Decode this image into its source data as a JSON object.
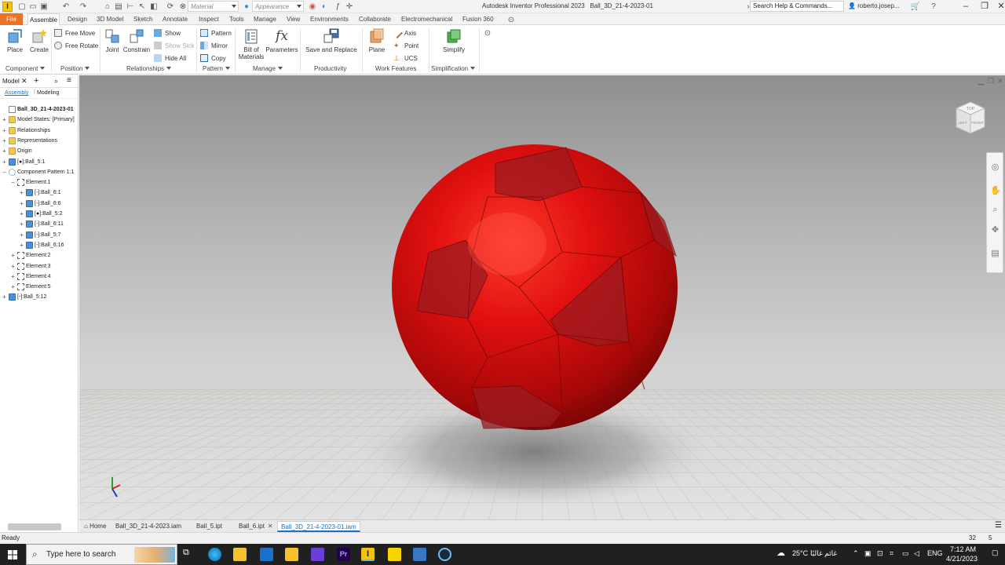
{
  "titlebar": {
    "material_placeholder": "Material",
    "appearance_placeholder": "Appearance",
    "app_title": "Autodesk Inventor Professional 2023",
    "doc_title": "Ball_3D_21-4-2023-01",
    "search_placeholder": "Search Help & Commands...",
    "user": "roberto.josep..."
  },
  "tabs": [
    "File",
    "Assemble",
    "Design",
    "3D Model",
    "Sketch",
    "Annotate",
    "Inspect",
    "Tools",
    "Manage",
    "View",
    "Environments",
    "Collaborate",
    "Electromechanical",
    "Fusion 360"
  ],
  "active_tab": "Assemble",
  "ribbon": {
    "component": {
      "place": "Place",
      "create": "Create",
      "label": "Component"
    },
    "position": {
      "free_move": "Free Move",
      "free_rotate": "Free Rotate",
      "label": "Position"
    },
    "relationships": {
      "joint": "Joint",
      "constrain": "Constrain",
      "show": "Show",
      "show_sick": "Show Sick",
      "hide_all": "Hide All",
      "label": "Relationships"
    },
    "pattern": {
      "pattern": "Pattern",
      "mirror": "Mirror",
      "copy": "Copy",
      "label": "Pattern"
    },
    "manage": {
      "bom_line1": "Bill of",
      "bom_line2": "Materials",
      "parameters": "Parameters",
      "label": "Manage"
    },
    "productivity": {
      "save_replace": "Save and Replace",
      "label": "Productivity"
    },
    "work_features": {
      "plane": "Plane",
      "axis": "Axis",
      "point": "Point",
      "ucs": "UCS",
      "label": "Work Features"
    },
    "simplification": {
      "simplify": "Simplify",
      "label": "Simplification"
    }
  },
  "browser": {
    "title": "Model",
    "subtab_assembly": "Assembly",
    "subtab_modeling": "Modeling",
    "tree": [
      {
        "label": "Ball_3D_21-4-2023-01",
        "indent": 0,
        "expander": "",
        "icon": "doc",
        "bold": true
      },
      {
        "label": "Model States: [Primary]",
        "indent": 0,
        "expander": "+",
        "icon": "folder"
      },
      {
        "label": "Relationships",
        "indent": 0,
        "expander": "+",
        "icon": "folder"
      },
      {
        "label": "Representations",
        "indent": 0,
        "expander": "+",
        "icon": "folder"
      },
      {
        "label": "Origin",
        "indent": 0,
        "expander": "+",
        "icon": "folder"
      },
      {
        "label": "[●]:Ball_5:1",
        "indent": 0,
        "expander": "+",
        "icon": "part"
      },
      {
        "label": "Component Pattern 1:1",
        "indent": 0,
        "expander": "−",
        "icon": "pattern"
      },
      {
        "label": "Element:1",
        "indent": 1,
        "expander": "−",
        "icon": "elem"
      },
      {
        "label": "[-]:Ball_6:1",
        "indent": 2,
        "expander": "+",
        "icon": "part"
      },
      {
        "label": "[-]:Ball_6:6",
        "indent": 2,
        "expander": "+",
        "icon": "part"
      },
      {
        "label": "[●]:Ball_5:2",
        "indent": 2,
        "expander": "+",
        "icon": "part"
      },
      {
        "label": "[-]:Ball_6:11",
        "indent": 2,
        "expander": "+",
        "icon": "part"
      },
      {
        "label": "[-]:Ball_5:7",
        "indent": 2,
        "expander": "+",
        "icon": "part"
      },
      {
        "label": "[-]:Ball_6:16",
        "indent": 2,
        "expander": "+",
        "icon": "part"
      },
      {
        "label": "Element:2",
        "indent": 1,
        "expander": "+",
        "icon": "elem"
      },
      {
        "label": "Element:3",
        "indent": 1,
        "expander": "+",
        "icon": "elem"
      },
      {
        "label": "Element:4",
        "indent": 1,
        "expander": "+",
        "icon": "elem"
      },
      {
        "label": "Element:5",
        "indent": 1,
        "expander": "+",
        "icon": "elem"
      },
      {
        "label": "[-]:Ball_5:12",
        "indent": 0,
        "expander": "+",
        "icon": "part"
      }
    ]
  },
  "viewcube": {
    "top": "TOP",
    "left": "LEFT",
    "front": "FRONT"
  },
  "doc_tabs": {
    "home": "Home",
    "items": [
      "Ball_3D_21-4-2023.iam",
      "Ball_5.ipt",
      "Ball_6.ipt",
      "Ball_3D_21-4-2023-01.iam"
    ],
    "active_index": 3
  },
  "status": {
    "text": "Ready",
    "count1": "32",
    "count2": "5"
  },
  "taskbar": {
    "search_placeholder": "Type here to search",
    "temperature": "25°C",
    "weather_text": "غائم غالبًا",
    "language": "ENG",
    "time": "7:12 AM",
    "date": "4/21/2023"
  },
  "colors": {
    "accent": "#1a73c9",
    "file_tab": "#e8742a",
    "ball": "#e01010"
  }
}
